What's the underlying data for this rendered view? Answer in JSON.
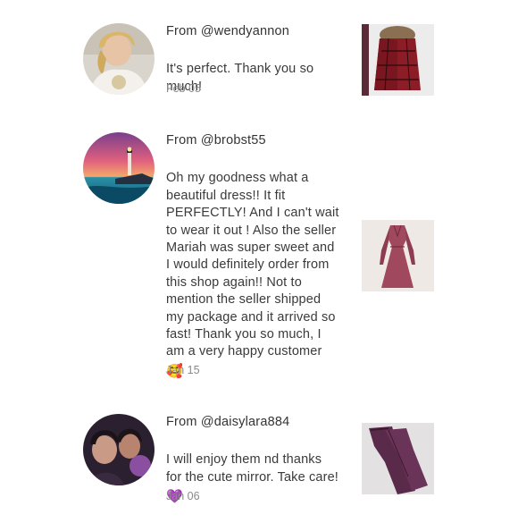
{
  "reviews": [
    {
      "from": "From @wendyannon",
      "text": "It's perfect. Thank you so\nmuch!",
      "emoji": "",
      "date": "Feb 05",
      "avatar_icon": "user-avatar-photo",
      "item_icon": "jacket-thumbnail"
    },
    {
      "from": "From @brobst55",
      "text": "Oh my goodness what a\nbeautiful dress!! It fit\nPERFECTLY! And I can't wait\nto wear it out ! Also the seller\nMariah was super sweet and\nI would definitely order from\nthis shop again!! Not to\nmention the seller shipped\nmy package and it arrived so\nfast! Thank you so much, I\nam a very happy customer",
      "emoji": "🥰",
      "date": "Jan 15",
      "avatar_icon": "lighthouse-avatar-photo",
      "item_icon": "dress-thumbnail"
    },
    {
      "from": "From @daisylara884",
      "text": "I will enjoy them nd thanks\nfor the cute mirror. Take care!",
      "emoji": "💜",
      "date": "Jan 06",
      "avatar_icon": "group-avatar-photo",
      "item_icon": "pants-thumbnail"
    }
  ]
}
